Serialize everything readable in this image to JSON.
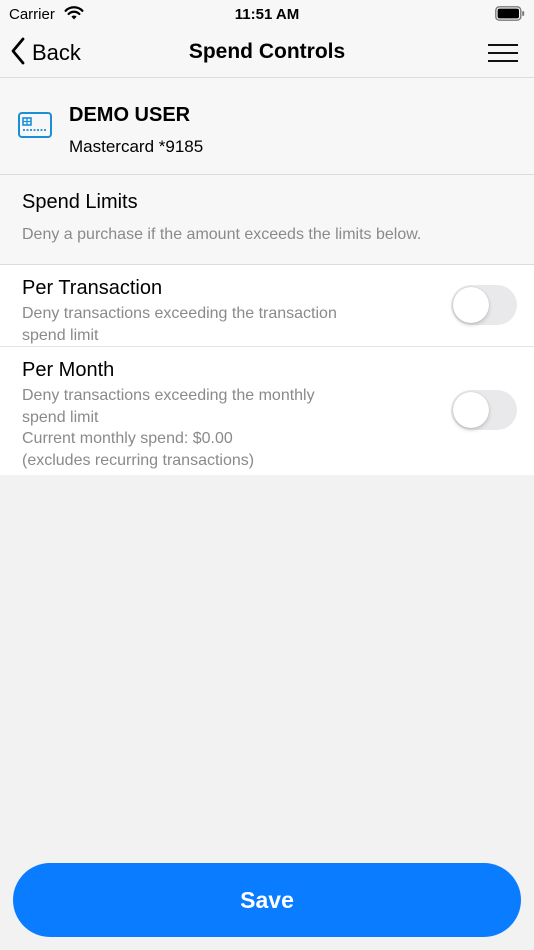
{
  "status_bar": {
    "carrier": "Carrier",
    "time": "11:51 AM"
  },
  "nav": {
    "back_label": "Back",
    "title": "Spend Controls"
  },
  "card": {
    "holder_name": "DEMO USER",
    "card_label": "Mastercard *9185",
    "icon": "credit-card-icon",
    "icon_color": "#1a8fd8"
  },
  "spend_limits": {
    "title": "Spend Limits",
    "description": "Deny a purchase if the amount exceeds the limits below."
  },
  "rows": [
    {
      "title": "Per Transaction",
      "description_lines": [
        "Deny transactions exceeding the transaction",
        "spend limit"
      ],
      "enabled": false
    },
    {
      "title": "Per Month",
      "description_lines": [
        "Deny transactions exceeding the monthly",
        "spend limit",
        "Current monthly spend: $0.00",
        "(excludes recurring transactions)"
      ],
      "enabled": false
    }
  ],
  "save_button": {
    "label": "Save"
  },
  "colors": {
    "accent": "#0a7cff",
    "secondary_text": "#8a8a8e",
    "toggle_off": "#e9e9eb"
  }
}
